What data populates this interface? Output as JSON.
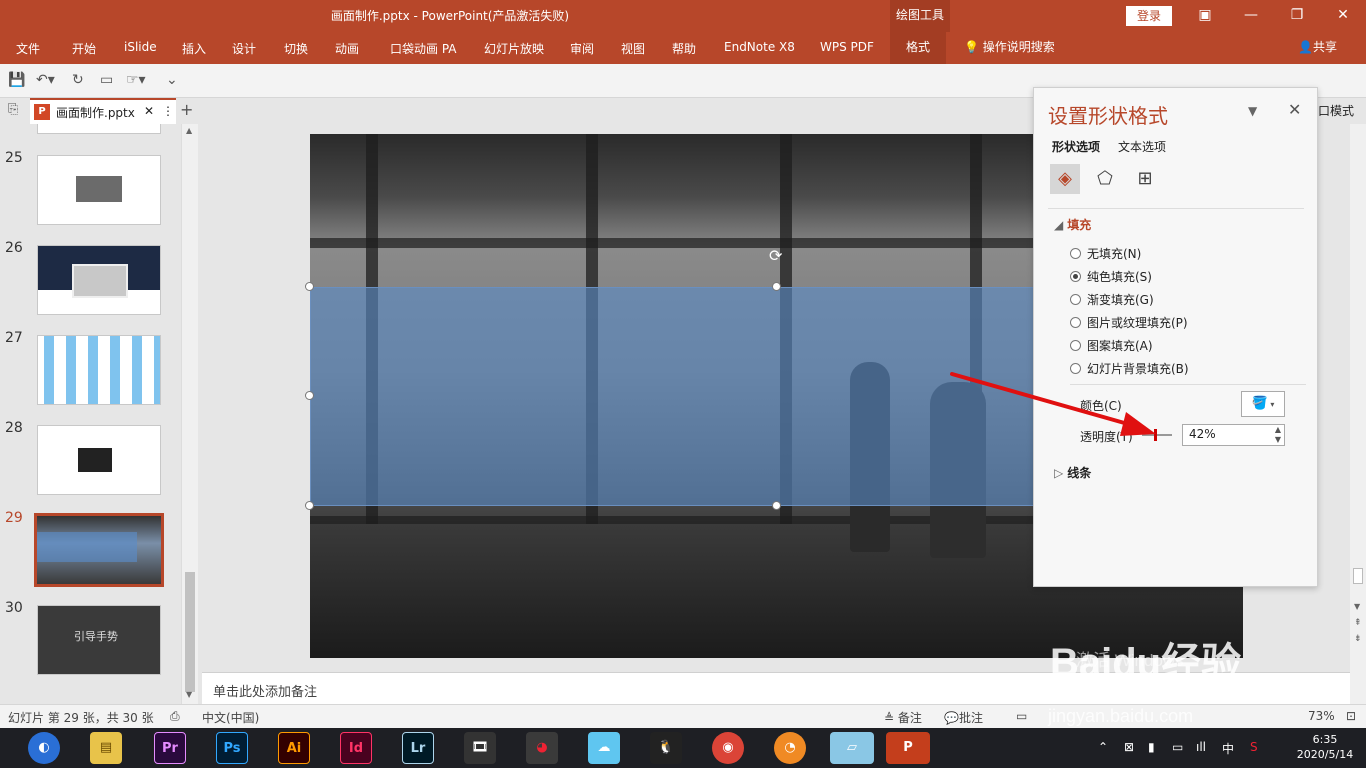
{
  "titlebar": {
    "title": "画面制作.pptx  -  PowerPoint(产品激活失败)",
    "context_tab": "绘图工具",
    "login": "登录",
    "restore_icon": "▣",
    "minimize": "—",
    "maximize": "❐",
    "close": "✕"
  },
  "ribbon": {
    "tabs": [
      "文件",
      "开始",
      "iSlide",
      "插入",
      "设计",
      "切换",
      "动画",
      "口袋动画 PA",
      "幻灯片放映",
      "审阅",
      "视图",
      "帮助",
      "EndNote X8",
      "WPS PDF"
    ],
    "active_tab": "格式",
    "help": "操作说明搜索",
    "share": "共享"
  },
  "doc_tab": {
    "name": "画面制作.pptx",
    "icon": "P",
    "close": "✕",
    "more": "⋮",
    "plus": "+"
  },
  "thumbnails": [
    {
      "num": "25"
    },
    {
      "num": "26"
    },
    {
      "num": "27"
    },
    {
      "num": "28"
    },
    {
      "num": "29",
      "active": true
    },
    {
      "num": "30",
      "caption": "引导手势"
    }
  ],
  "format_pane": {
    "title": "设置形状格式",
    "tab_shape": "形状选项",
    "tab_text": "文本选项",
    "icons": [
      "fill-line-icon",
      "effects-icon",
      "size-properties-icon"
    ],
    "fill_section": "填充",
    "fill_options": [
      {
        "label": "无填充(N)",
        "selected": false
      },
      {
        "label": "纯色填充(S)",
        "selected": true
      },
      {
        "label": "渐变填充(G)",
        "selected": false
      },
      {
        "label": "图片或纹理填充(P)",
        "selected": false
      },
      {
        "label": "图案填充(A)",
        "selected": false
      },
      {
        "label": "幻灯片背景填充(B)",
        "selected": false
      }
    ],
    "color_label": "颜色(C)",
    "transparency_label": "透明度(T)",
    "transparency_value": "42%",
    "line_section": "线条",
    "fill_color": "#4472c4",
    "transparency_fraction": 0.42
  },
  "mode_label": "口模式",
  "notes": {
    "placeholder": "单击此处添加备注"
  },
  "status": {
    "slide_info": "幻灯片 第 29 张，共 30 张",
    "language": "中文(中国)",
    "notes": "备注",
    "comments": "批注",
    "zoom": "73%"
  },
  "watermark": {
    "activate": "激活 Windows",
    "baidu": "Baidu经验",
    "url": "jingyan.baidu.com"
  },
  "taskbar": {
    "apps": [
      "Pr",
      "Ps",
      "Ai",
      "Id",
      "Lr"
    ],
    "tray_lang": "中",
    "time": "6:35",
    "date": "2020/5/14"
  },
  "colors": {
    "accent": "#b7472a",
    "shape_fill": "#5a8cc8"
  }
}
